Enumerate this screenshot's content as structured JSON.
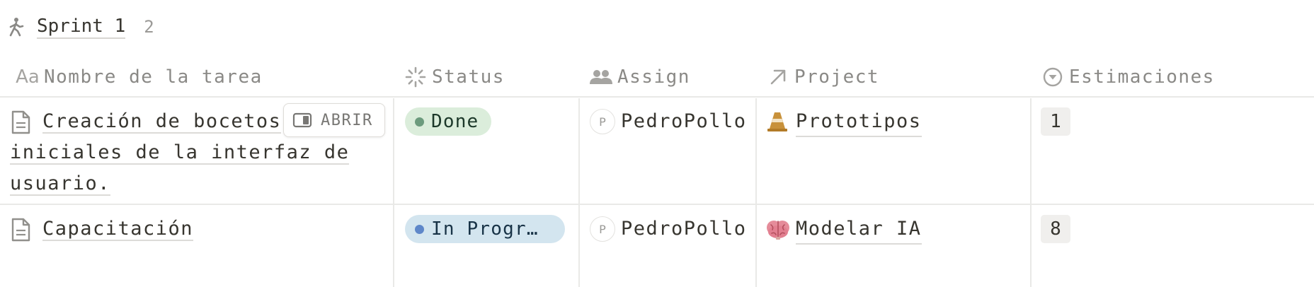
{
  "group": {
    "icon": "person-walking-icon",
    "title": "Sprint 1",
    "count": "2"
  },
  "columns": [
    {
      "key": "name",
      "label": "Nombre de la tarea",
      "icon": "title-aa-icon"
    },
    {
      "key": "status",
      "label": "Status",
      "icon": "status-spinner-icon"
    },
    {
      "key": "assign",
      "label": "Assign",
      "icon": "people-icon"
    },
    {
      "key": "project",
      "label": "Project",
      "icon": "relation-arrow-icon"
    },
    {
      "key": "estimate",
      "label": "Estimaciones",
      "icon": "select-chevron-icon"
    }
  ],
  "columns_aa_glyph": "Aa",
  "open_button": {
    "label": "ABRIR",
    "icon": "side-peek-icon"
  },
  "rows": [
    {
      "name": "Creación de bocetos iniciales de la interfaz de usuario.",
      "status": "Done",
      "status_color": "#dbeddb",
      "assign_initial": "P",
      "assign": "PedroPollo",
      "project_icon": "traffic-cone-icon",
      "project": "Prototipos",
      "estimate": "1"
    },
    {
      "name": "Capacitación",
      "status": "In Progr…",
      "status_color": "#d3e5ef",
      "assign_initial": "P",
      "assign": "PedroPollo",
      "project_icon": "brain-icon",
      "project": "Modelar IA",
      "estimate": "8"
    }
  ]
}
